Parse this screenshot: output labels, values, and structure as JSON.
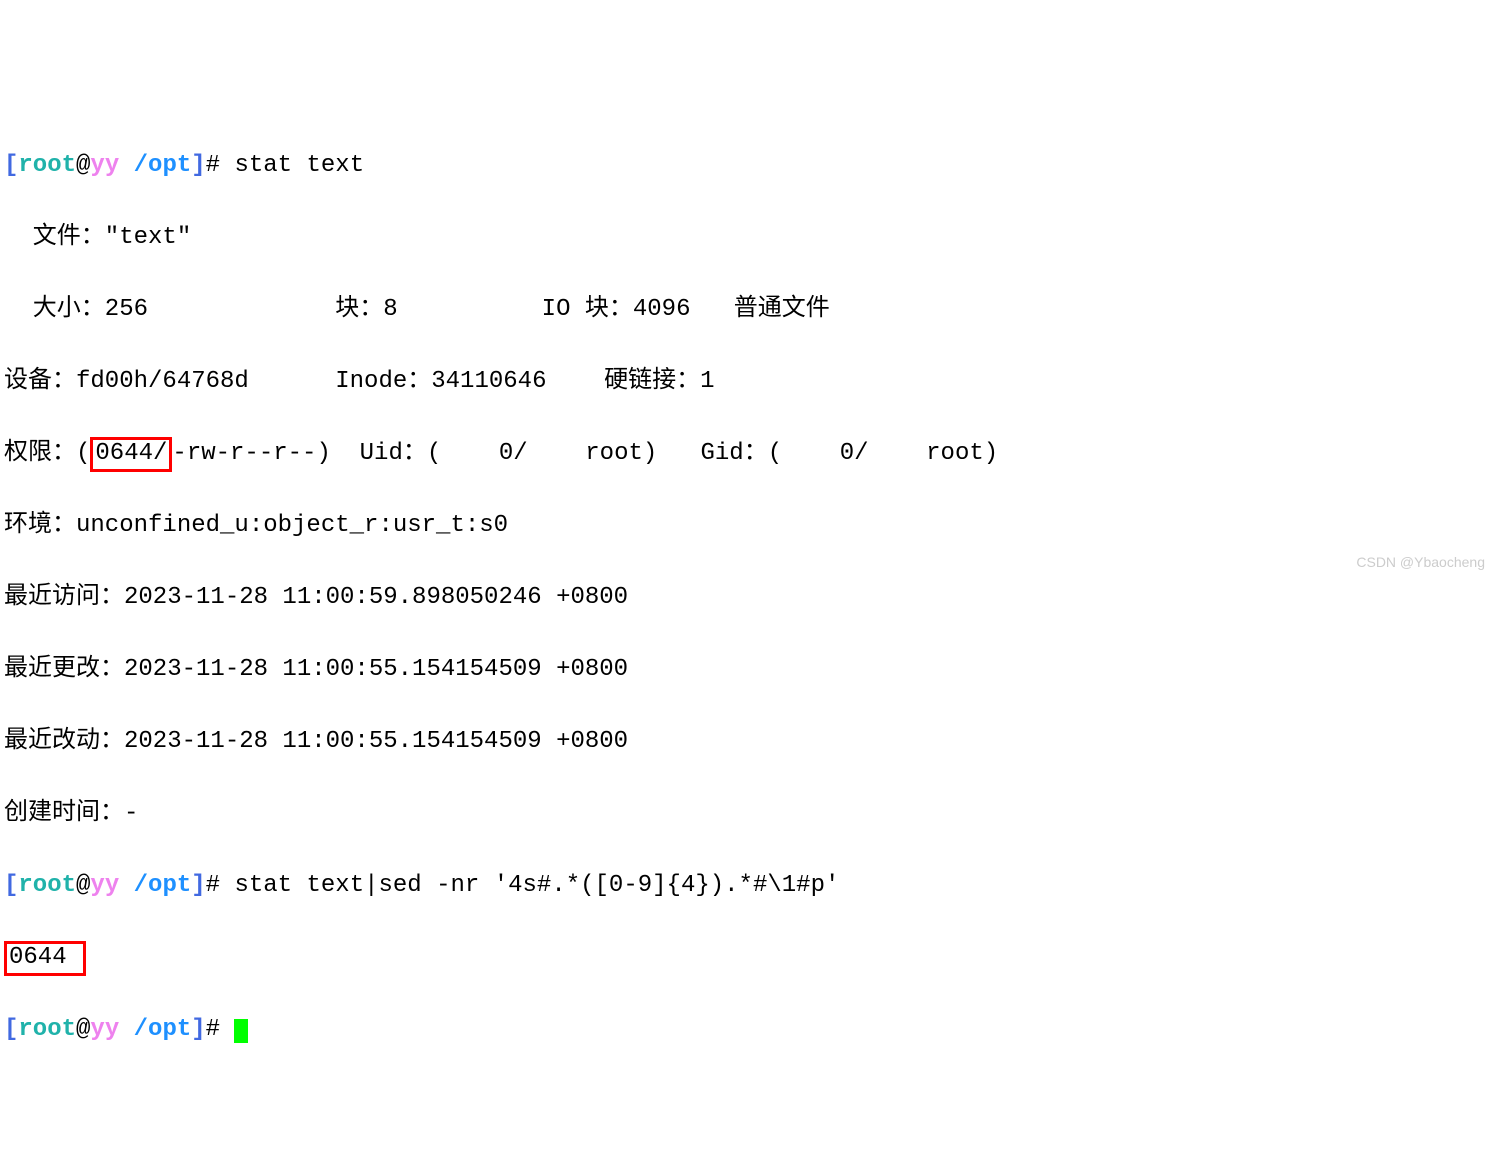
{
  "prompt": {
    "lbracket": "[",
    "user": "root",
    "at": "@",
    "host": "yy",
    "space": " ",
    "path": "/opt",
    "rbracket": "]",
    "hash": "# "
  },
  "cmd1": "stat text",
  "out": {
    "l1_pre": "  文件：\"text\"",
    "l2": "  大小：256             块：8          IO 块：4096   普通文件",
    "l3": "设备：fd00h/64768d      Inode：34110646    硬链接：1",
    "l4_pre": "权限：(",
    "l4_box": "0644/",
    "l4_post": "-rw-r--r--)  Uid：(    0/    root)   Gid：(    0/    root)",
    "l5": "环境：unconfined_u:object_r:usr_t:s0",
    "l6": "最近访问：2023-11-28 11:00:59.898050246 +0800",
    "l7": "最近更改：2023-11-28 11:00:55.154154509 +0800",
    "l8": "最近改动：2023-11-28 11:00:55.154154509 +0800",
    "l9": "创建时间：-"
  },
  "cmd2": "stat text|sed -nr '4s#.*([0-9]{4}).*#\\1#p'",
  "result_box": "0644 ",
  "watermark": "CSDN @Ybaocheng"
}
